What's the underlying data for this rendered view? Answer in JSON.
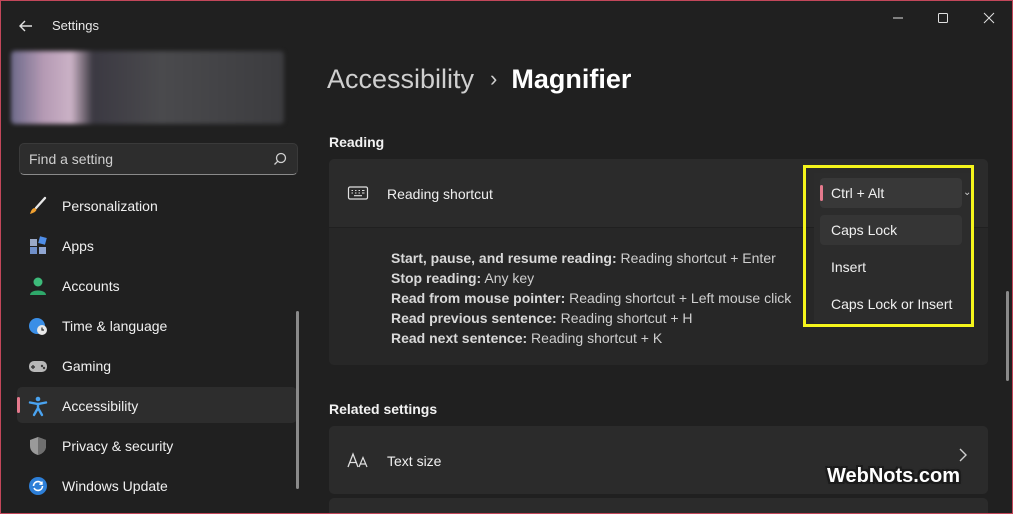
{
  "window": {
    "title": "Settings",
    "controls": [
      "minimize",
      "maximize",
      "close"
    ]
  },
  "search": {
    "placeholder": "Find a setting"
  },
  "sidebar": {
    "items": [
      {
        "label": "Personalization",
        "icon": "brush-icon",
        "active": false
      },
      {
        "label": "Apps",
        "icon": "apps-icon",
        "active": false
      },
      {
        "label": "Accounts",
        "icon": "accounts-icon",
        "active": false
      },
      {
        "label": "Time & language",
        "icon": "globe-clock-icon",
        "active": false
      },
      {
        "label": "Gaming",
        "icon": "gamepad-icon",
        "active": false
      },
      {
        "label": "Accessibility",
        "icon": "accessibility-icon",
        "active": true
      },
      {
        "label": "Privacy & security",
        "icon": "shield-icon",
        "active": false
      },
      {
        "label": "Windows Update",
        "icon": "update-icon",
        "active": false
      }
    ]
  },
  "breadcrumb": {
    "parent": "Accessibility",
    "separator": "›",
    "current": "Magnifier"
  },
  "reading": {
    "heading": "Reading",
    "shortcut_label": "Reading shortcut",
    "instructions": [
      {
        "bold": "Start, pause, and resume reading:",
        "text": " Reading shortcut + Enter"
      },
      {
        "bold": "Stop reading:",
        "text": " Any key"
      },
      {
        "bold": "Read from mouse pointer:",
        "text": " Reading shortcut + Left mouse click"
      },
      {
        "bold": "Read previous sentence:",
        "text": " Reading shortcut + H"
      },
      {
        "bold": "Read next sentence:",
        "text": " Reading shortcut + K"
      }
    ]
  },
  "dropdown": {
    "selected": "Ctrl + Alt",
    "options": [
      "Caps Lock",
      "Insert",
      "Caps Lock or Insert"
    ]
  },
  "related": {
    "heading": "Related settings",
    "items": [
      {
        "label": "Text size",
        "icon": "text-size-icon"
      }
    ]
  },
  "watermark": "WebNots.com",
  "colors": {
    "accent": "#e57a8d",
    "highlight": "#f5f51b",
    "background": "#202020",
    "card": "#2b2b2b"
  }
}
